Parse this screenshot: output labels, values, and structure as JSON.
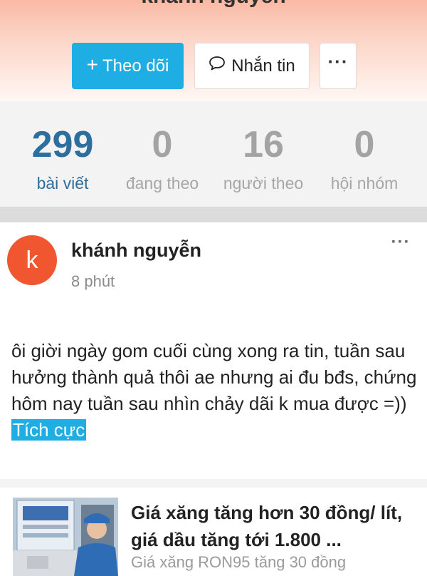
{
  "profile": {
    "name": "khánh nguyễn",
    "follow_button": "Theo dõi",
    "message_button": "Nhắn tin",
    "more_label": "···"
  },
  "stats": [
    {
      "value": "299",
      "label": "bài viết",
      "active": true
    },
    {
      "value": "0",
      "label": "đang theo",
      "active": false
    },
    {
      "value": "16",
      "label": "người theo",
      "active": false
    },
    {
      "value": "0",
      "label": "hội nhóm",
      "active": false
    }
  ],
  "post": {
    "avatar_letter": "k",
    "author": "khánh nguyễn",
    "time": "8 phút",
    "menu_label": "···",
    "text": "ôi giời ngày gom cuối cùng xong ra tin, tuần sau hưởng thành quả thôi ae nhưng ai đu bđs, chứng hôm nay tuần sau nhìn chảy dãi k mua được =))",
    "hashtag": "Tích cực",
    "link_card": {
      "title": "Giá xăng tăng hơn 30 đồng/ lít, giá dầu tăng tới 1.800 ...",
      "description": "Giá xăng RON95 tăng 30 đồng"
    }
  },
  "colors": {
    "accent": "#1faee3",
    "active_stat": "#2c6e9e",
    "avatar": "#f0562f"
  }
}
